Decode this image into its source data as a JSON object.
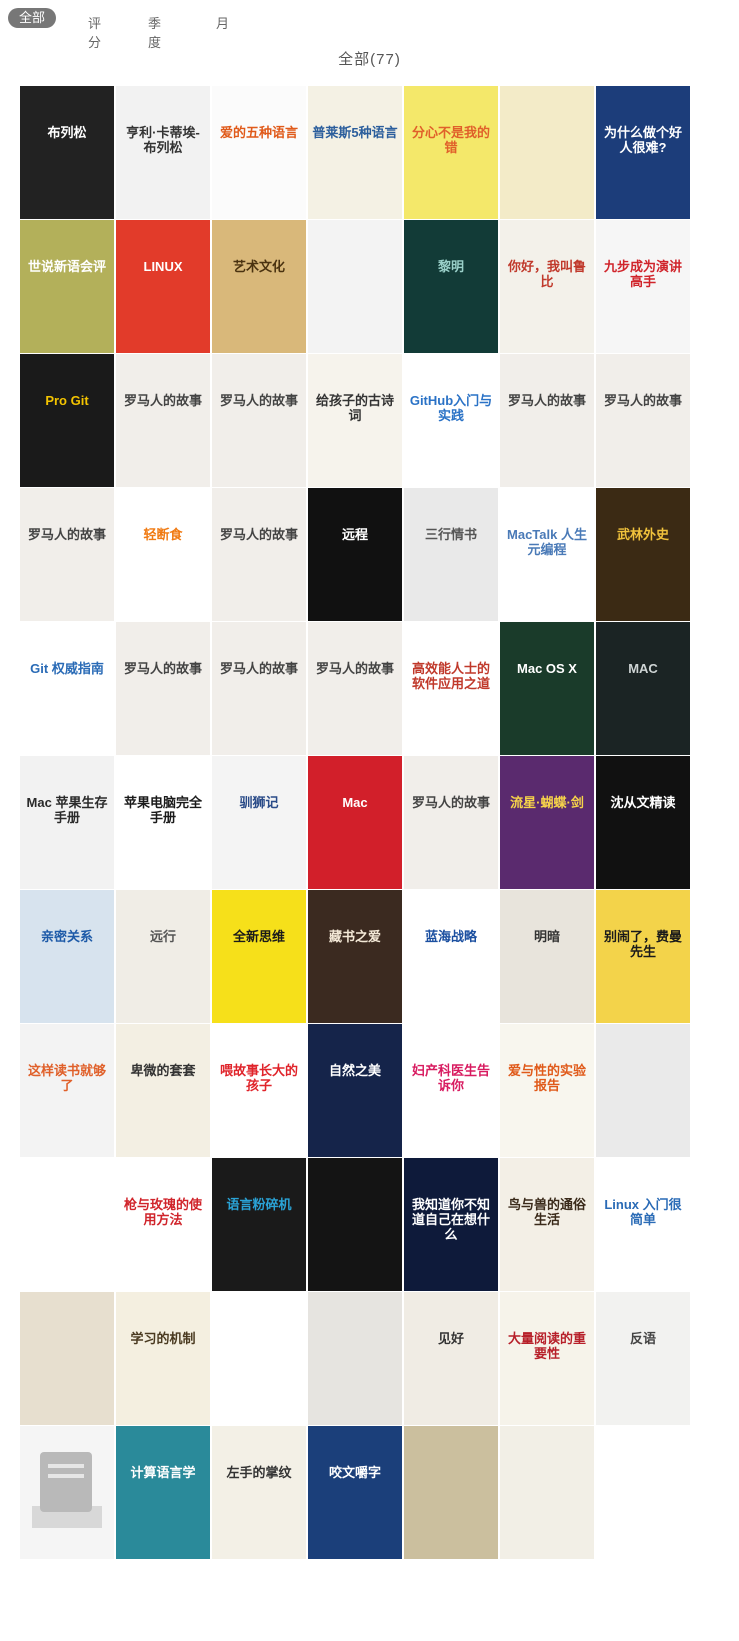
{
  "tabs": [
    {
      "label": "全部",
      "active": true
    },
    {
      "label": "评分",
      "active": false
    },
    {
      "label": "季度",
      "active": false
    },
    {
      "label": "月",
      "active": false
    }
  ],
  "count_label": "全部(77)",
  "books": [
    {
      "title": "布列松",
      "bg": "#222222",
      "fg": "#ffffff"
    },
    {
      "title": "亨利·卡蒂埃-布列松",
      "bg": "#f2f2f2",
      "fg": "#333333"
    },
    {
      "title": "爱的五种语言",
      "bg": "#fbfbfb",
      "fg": "#e05a1a"
    },
    {
      "title": "普莱斯5种语言",
      "bg": "#f4f1e4",
      "fg": "#2b5e9c"
    },
    {
      "title": "分心不是我的错",
      "bg": "#f4e86a",
      "fg": "#e0602a"
    },
    {
      "title": "",
      "bg": "#f3ebc8",
      "fg": "#6b5a2b"
    },
    {
      "title": "为什么做个好人很难?",
      "bg": "#1c3d7a",
      "fg": "#ffffff"
    },
    {
      "title": "世说新语会评",
      "bg": "#b3b05a",
      "fg": "#ffffff"
    },
    {
      "title": "LINUX",
      "bg": "#e23b2a",
      "fg": "#ffffff"
    },
    {
      "title": "艺术文化",
      "bg": "#d9b87a",
      "fg": "#4a3210"
    },
    {
      "title": "",
      "bg": "#f3f3f3",
      "fg": "#333333"
    },
    {
      "title": "黎明",
      "bg": "#123b37",
      "fg": "#9ad0c9"
    },
    {
      "title": "你好，我叫鲁比",
      "bg": "#f3f1ea",
      "fg": "#c0392b"
    },
    {
      "title": "九步成为演讲高手",
      "bg": "#f6f6f6",
      "fg": "#d0242b"
    },
    {
      "title": "Pro Git",
      "bg": "#1a1a1a",
      "fg": "#f4c400"
    },
    {
      "title": "罗马人的故事",
      "bg": "#f1eeea",
      "fg": "#444444"
    },
    {
      "title": "罗马人的故事",
      "bg": "#f1eeea",
      "fg": "#444444"
    },
    {
      "title": "给孩子的古诗词",
      "bg": "#f6f3ec",
      "fg": "#333333"
    },
    {
      "title": "GitHub入门与实践",
      "bg": "#ffffff",
      "fg": "#2a72c6"
    },
    {
      "title": "罗马人的故事",
      "bg": "#f1eeea",
      "fg": "#444444"
    },
    {
      "title": "罗马人的故事",
      "bg": "#f1eeea",
      "fg": "#444444"
    },
    {
      "title": "罗马人的故事",
      "bg": "#f1eeea",
      "fg": "#444444"
    },
    {
      "title": "轻断食",
      "bg": "#ffffff",
      "fg": "#f07a12"
    },
    {
      "title": "罗马人的故事",
      "bg": "#f1eeea",
      "fg": "#444444"
    },
    {
      "title": "远程",
      "bg": "#111111",
      "fg": "#ffffff"
    },
    {
      "title": "三行情书",
      "bg": "#e9e9e9",
      "fg": "#555555"
    },
    {
      "title": "MacTalk 人生元编程",
      "bg": "#ffffff",
      "fg": "#4a7ab7"
    },
    {
      "title": "武林外史",
      "bg": "#3b2a14",
      "fg": "#f0c23c"
    },
    {
      "title": "Git 权威指南",
      "bg": "#ffffff",
      "fg": "#2a6bb6"
    },
    {
      "title": "罗马人的故事",
      "bg": "#f1eeea",
      "fg": "#444444"
    },
    {
      "title": "罗马人的故事",
      "bg": "#f1eeea",
      "fg": "#444444"
    },
    {
      "title": "罗马人的故事",
      "bg": "#f1eeea",
      "fg": "#444444"
    },
    {
      "title": "高效能人士的软件应用之道",
      "bg": "#ffffff",
      "fg": "#c0392b"
    },
    {
      "title": "Mac OS X",
      "bg": "#1a3b2a",
      "fg": "#ffffff"
    },
    {
      "title": "MAC",
      "bg": "#1b2424",
      "fg": "#cfd5d5"
    },
    {
      "title": "Mac 苹果生存手册",
      "bg": "#f2f2f2",
      "fg": "#2a2a2a"
    },
    {
      "title": "苹果电脑完全手册",
      "bg": "#ffffff",
      "fg": "#1a1a1a"
    },
    {
      "title": "驯狮记",
      "bg": "#f4f4f4",
      "fg": "#2a4b88"
    },
    {
      "title": "Mac",
      "bg": "#d21f2a",
      "fg": "#ffffff"
    },
    {
      "title": "罗马人的故事",
      "bg": "#f1eeea",
      "fg": "#444444"
    },
    {
      "title": "流星·蝴蝶·剑",
      "bg": "#5a2a6e",
      "fg": "#f6d34a"
    },
    {
      "title": "沈从文精读",
      "bg": "#111111",
      "fg": "#ffffff"
    },
    {
      "title": "亲密关系",
      "bg": "#d7e3ee",
      "fg": "#1d5aa8"
    },
    {
      "title": "远行",
      "bg": "#f0ede6",
      "fg": "#555555"
    },
    {
      "title": "全新思维",
      "bg": "#f6e01a",
      "fg": "#1a1a1a"
    },
    {
      "title": "藏书之爱",
      "bg": "#3b2a20",
      "fg": "#f3e8d6"
    },
    {
      "title": "蓝海战略",
      "bg": "#ffffff",
      "fg": "#1b4fa0"
    },
    {
      "title": "明暗",
      "bg": "#e8e4dc",
      "fg": "#333333"
    },
    {
      "title": "别闹了，费曼先生",
      "bg": "#f3d34a",
      "fg": "#1a1a1a"
    },
    {
      "title": "这样读书就够了",
      "bg": "#f3f3f3",
      "fg": "#e0602a"
    },
    {
      "title": "卑微的套套",
      "bg": "#f3efe3",
      "fg": "#333333"
    },
    {
      "title": "喂故事长大的孩子",
      "bg": "#ffffff",
      "fg": "#e0242b"
    },
    {
      "title": "自然之美",
      "bg": "#15244a",
      "fg": "#ffffff"
    },
    {
      "title": "妇产科医生告诉你",
      "bg": "#ffffff",
      "fg": "#d81b60"
    },
    {
      "title": "爱与性的实验报告",
      "bg": "#f8f6ee",
      "fg": "#e05a1a"
    },
    {
      "title": "",
      "bg": "#eaeaea",
      "fg": "#f07a12"
    },
    {
      "title": "",
      "bg": "#ffffff",
      "fg": "#4a7a2a"
    },
    {
      "title": "枪与玫瑰的使用方法",
      "bg": "#ffffff",
      "fg": "#d0242b"
    },
    {
      "title": "语言粉碎机",
      "bg": "#1a1a1a",
      "fg": "#2aa3d6"
    },
    {
      "title": "",
      "bg": "#141414",
      "fg": "#ffffff"
    },
    {
      "title": "我知道你不知道自己在想什么",
      "bg": "#0e1a3a",
      "fg": "#ffffff"
    },
    {
      "title": "鸟与兽的通俗生活",
      "bg": "#f3efe6",
      "fg": "#3a2a1a"
    },
    {
      "title": "Linux 入门很简单",
      "bg": "#ffffff",
      "fg": "#2a6bb6"
    },
    {
      "title": "",
      "bg": "#e7dfcf",
      "fg": "#6a5a3a"
    },
    {
      "title": "学习的机制",
      "bg": "#f4efe0",
      "fg": "#4a3a20"
    },
    {
      "title": "",
      "bg": "#ffffff",
      "fg": "#d0242b"
    },
    {
      "title": "",
      "bg": "#e6e4e0",
      "fg": "#333333"
    },
    {
      "title": "见好",
      "bg": "#f0ece4",
      "fg": "#333333"
    },
    {
      "title": "大量阅读的重要性",
      "bg": "#f6f3ea",
      "fg": "#b7202a"
    },
    {
      "title": "反语",
      "bg": "#f2f2f0",
      "fg": "#444444"
    },
    {
      "title": "",
      "bg": "#f5f5f5",
      "fg": "#999999",
      "placeholder": true
    },
    {
      "title": "计算语言学",
      "bg": "#2a8a9a",
      "fg": "#ffffff"
    },
    {
      "title": "左手的掌纹",
      "bg": "#f3f0e6",
      "fg": "#333333"
    },
    {
      "title": "咬文嚼字",
      "bg": "#1b3f7a",
      "fg": "#ffffff"
    },
    {
      "title": "",
      "bg": "#cbbf9e",
      "fg": "#3a2a1a"
    },
    {
      "title": "",
      "bg": "#f2efe6",
      "fg": "#333333"
    },
    {
      "title": "",
      "bg": "#ffffff",
      "fg": "#333333"
    }
  ]
}
